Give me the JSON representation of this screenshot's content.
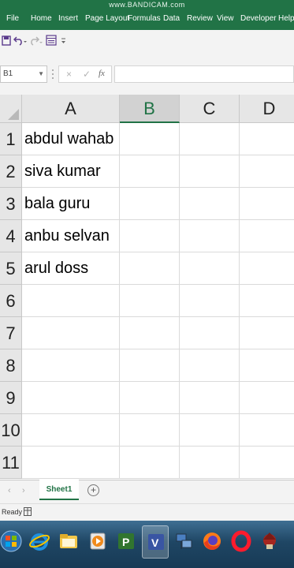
{
  "watermark": "www.BANDICAM.com",
  "ribbon": {
    "tabs": [
      "File",
      "Home",
      "Insert",
      "Page Layout",
      "Formulas",
      "Data",
      "Review",
      "View",
      "Developer",
      "Help"
    ]
  },
  "quick_access": {
    "icons": [
      "save-icon",
      "undo-icon",
      "redo-icon",
      "form-icon",
      "customize-icon"
    ]
  },
  "formula_bar": {
    "name_box": "B1",
    "cancel_glyph": "×",
    "enter_glyph": "✓",
    "fx_label": "fx",
    "value": ""
  },
  "grid": {
    "selected_cell": "B1",
    "columns": [
      "A",
      "B",
      "C",
      "D"
    ],
    "rows": [
      "1",
      "2",
      "3",
      "4",
      "5",
      "6",
      "7",
      "8",
      "9",
      "10",
      "11"
    ],
    "column_a_values": [
      "abdul wahab",
      "siva kumar",
      "bala guru",
      "anbu selvan",
      "arul doss",
      "",
      "",
      "",
      "",
      "",
      ""
    ]
  },
  "sheets": {
    "tabs": [
      "Sheet1"
    ],
    "active": "Sheet1",
    "add_label": "+"
  },
  "status": {
    "text": "Ready"
  },
  "taskbar": {
    "items": [
      "start-orb",
      "internet-explorer",
      "file-explorer",
      "media-player",
      "project",
      "visio",
      "network",
      "firefox",
      "opera",
      "app-icon"
    ]
  },
  "colors": {
    "accent": "#217346",
    "taskbar": "#1f4664"
  }
}
